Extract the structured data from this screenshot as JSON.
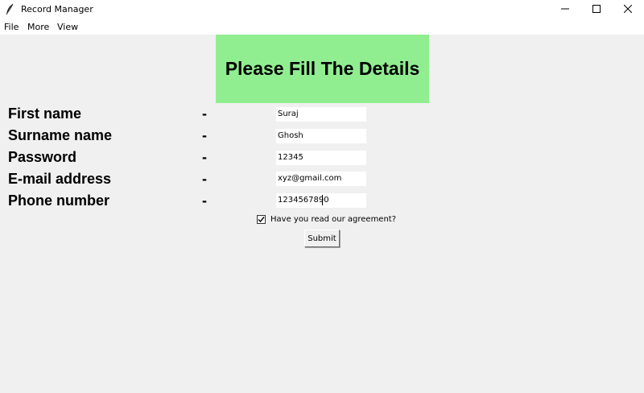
{
  "window": {
    "title": "Record Manager",
    "icon": "feather-icon",
    "controls": [
      "minimize-icon",
      "maximize-icon",
      "close-icon"
    ]
  },
  "menu": {
    "items": [
      {
        "label": "File"
      },
      {
        "label": "More"
      },
      {
        "label": "View"
      }
    ]
  },
  "form": {
    "heading": "Please Fill The Details",
    "heading_bg": "#90ee90",
    "separator": "-",
    "fields": [
      {
        "label": "First name",
        "value": "Suraj"
      },
      {
        "label": "Surname name",
        "value": "Ghosh"
      },
      {
        "label": "Password",
        "value": "12345"
      },
      {
        "label": "E-mail address",
        "value": "xyz@gmail.com"
      },
      {
        "label": "Phone number",
        "value": "1234567890"
      }
    ],
    "agreement": {
      "label": "Have you read our agreement?",
      "checked": true
    },
    "submit_label": "Submit"
  }
}
